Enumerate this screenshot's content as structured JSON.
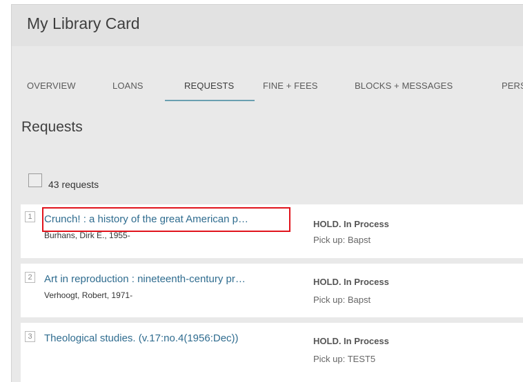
{
  "header": {
    "title": "My Library Card"
  },
  "tabs": [
    {
      "label": "OVERVIEW"
    },
    {
      "label": "LOANS"
    },
    {
      "label": "REQUESTS",
      "active": true
    },
    {
      "label": "FINE + FEES"
    },
    {
      "label": "BLOCKS + MESSAGES"
    },
    {
      "label": "PERS"
    }
  ],
  "requests_section": {
    "title": "Requests",
    "count_label": "43 requests"
  },
  "requests": [
    {
      "num": "1",
      "title": "Crunch! : a history of the great American p…",
      "author": "Burhans, Dirk E., 1955-",
      "status": "HOLD. In Process",
      "pickup": "Pick up: Bapst"
    },
    {
      "num": "2",
      "title": "Art in reproduction : nineteenth-century pr…",
      "author": "Verhoogt, Robert, 1971-",
      "status": "HOLD. In Process",
      "pickup": "Pick up: Bapst"
    },
    {
      "num": "3",
      "title": "Theological studies. (v.17:no.4(1956:Dec))",
      "author": "",
      "status": "HOLD. In Process",
      "pickup": "Pick up: TEST5"
    }
  ],
  "colors": {
    "link": "#2f6c8f",
    "tab_underline": "#6a9fb0",
    "highlight": "#e0121b"
  }
}
